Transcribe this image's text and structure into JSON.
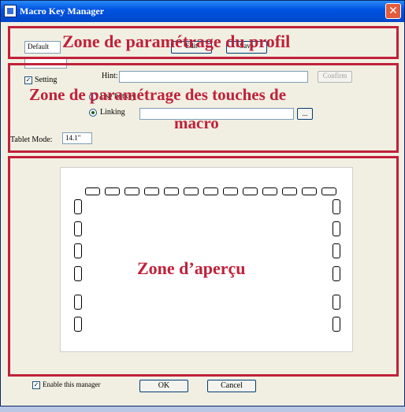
{
  "window": {
    "title": "Macro Key Manager",
    "close_glyph": "✕"
  },
  "profile": {
    "name": "Default",
    "button_1": "Edit",
    "button_2": "Save"
  },
  "key_select": {
    "value": ""
  },
  "macro": {
    "setting_label": "Setting",
    "setting_checked": true,
    "hint_label": "Hint:",
    "hint_value": "",
    "confirm_label": "Confirm",
    "hotkey_label": "Use hotkey",
    "linking_label": "Linking",
    "linking_value": "",
    "browse_label": "...",
    "tablet_mode_label": "Tablet Mode:",
    "tablet_mode_value": "14.1\""
  },
  "annotations": {
    "profile_zone": "Zone de paramétrage du profil",
    "macro_zone_line1": "Zone de paramétrage des touches de",
    "macro_zone_line2": "macro",
    "preview_zone": "Zone d’aperçu",
    "zone_color": "#c0213a"
  },
  "footer": {
    "enable_label": "Enable this manager",
    "enable_checked": true,
    "ok_label": "OK",
    "cancel_label": "Cancel"
  }
}
